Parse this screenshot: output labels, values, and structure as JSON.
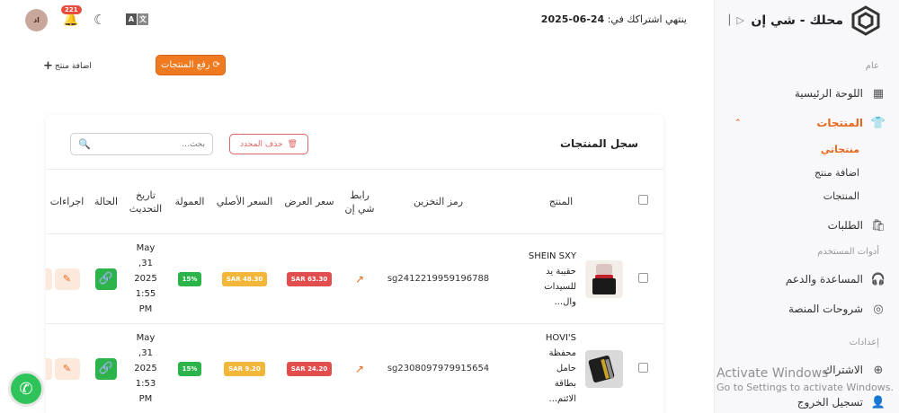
{
  "sidebar": {
    "brand": "محلك - شي إن",
    "collapse_icon": "chevrons-right",
    "sections": {
      "general": "عام",
      "user_tools": "أدوات المستخدم",
      "settings": "إعدادات"
    },
    "items": {
      "dashboard": "اللوحة الرئيسية",
      "products": "المنتجات",
      "orders": "الطلبات",
      "help": "المساعدة والدعم",
      "terms": "شروحات المنصة",
      "subscription": "الاشتراك",
      "logout": "تسجيل الخروج"
    },
    "sub_items": {
      "my_products": "منتجاتي",
      "add_product": "اضافة منتج",
      "products": "المنتجات"
    },
    "accent": "#e8661b"
  },
  "topbar": {
    "subscription_label": "ينتهي اشتراكك في:",
    "subscription_date": "24-06-2025",
    "notifications_count": "221",
    "avatar_initials": "اد",
    "lang_a": "A",
    "lang_b": "文"
  },
  "actions": {
    "upload_label": "رفع المنتجات",
    "add_product_label": "اضافة منتج"
  },
  "card": {
    "title": "سجل المنتجات",
    "delete_selected": "حذف المحدد",
    "search_placeholder": "بحث..."
  },
  "table": {
    "headers": {
      "product": "المنتج",
      "sku": "رمز التخزين",
      "link": "رابط شي إن",
      "offer_price": "سعر العرض",
      "original_price": "السعر الأصلي",
      "commission": "العمولة",
      "updated": "تاريخ التحديث",
      "status": "الحالة",
      "actions": "اجراءات"
    },
    "rows": [
      {
        "name_1": "SHEIN SXY",
        "name_2": "حقيبة يد",
        "name_3": "للسيدات",
        "name_4": "وال...",
        "sku": "sg2412219959196788",
        "offer_price": "63.30 SAR",
        "original_price": "48.30 SAR",
        "commission": "15%",
        "date_1": "May",
        "date_2": "31,",
        "date_3": "2025",
        "date_4": "1:55",
        "date_5": "PM"
      },
      {
        "name_1": "HOVI'S",
        "name_2": "محفظة",
        "name_3": "حامل",
        "name_4": "بطاقة",
        "name_5": "الائتم...",
        "sku": "sg2308097979915654",
        "offer_price": "24.20 SAR",
        "original_price": "9.20 SAR",
        "commission": "15%",
        "date_1": "May",
        "date_2": "31,",
        "date_3": "2025",
        "date_4": "1:53",
        "date_5": "PM"
      }
    ]
  },
  "watermark": {
    "line1": "Activate Windows",
    "line2": "Go to Settings to activate Windows."
  }
}
